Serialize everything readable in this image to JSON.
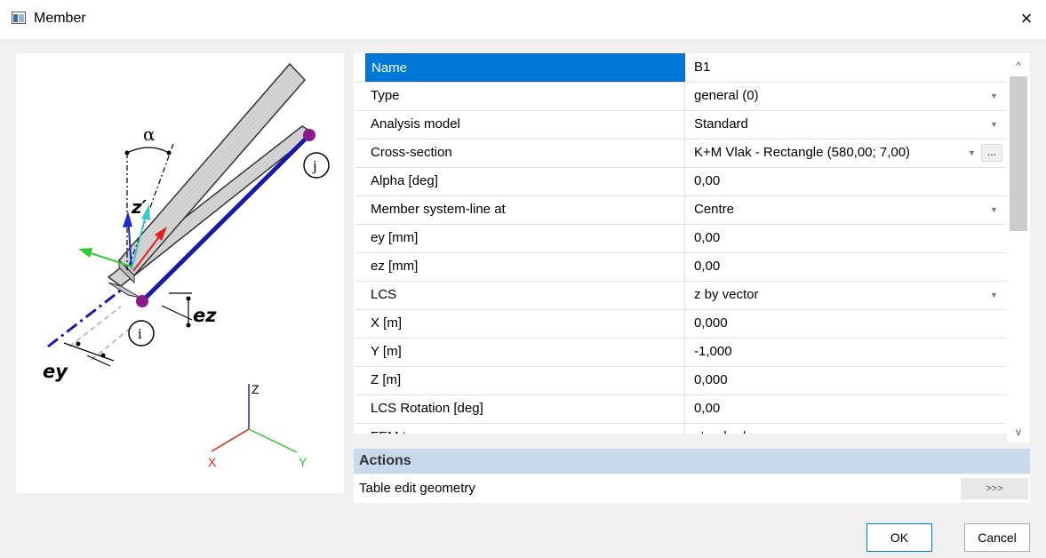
{
  "window": {
    "title": "Member",
    "close_glyph": "×",
    "app_icon": "window-icon"
  },
  "diagram": {
    "alpha_label": "α",
    "z_prime_label": "z′",
    "node_j": "j",
    "node_i": "i",
    "ez_label": "ez",
    "ey_label": "ey",
    "axis_z": "Z",
    "axis_x": "X",
    "axis_y": "Y"
  },
  "properties": [
    {
      "name": "Name",
      "value": "B1",
      "control": "text"
    },
    {
      "name": "Type",
      "value": "general (0)",
      "control": "dropdown"
    },
    {
      "name": "Analysis model",
      "value": "Standard",
      "control": "dropdown"
    },
    {
      "name": "Cross-section",
      "value": "K+M Vlak - Rectangle (580,00; 7,00)",
      "control": "dropdown-ellipsis"
    },
    {
      "name": "Alpha [deg]",
      "value": "0,00",
      "control": "text"
    },
    {
      "name": "Member system-line at",
      "value": "Centre",
      "control": "dropdown"
    },
    {
      "name": "ey [mm]",
      "value": "0,00",
      "control": "text"
    },
    {
      "name": "ez [mm]",
      "value": "0,00",
      "control": "text"
    },
    {
      "name": "LCS",
      "value": "z by vector",
      "control": "dropdown"
    },
    {
      "name": "X [m]",
      "value": "0,000",
      "control": "text"
    },
    {
      "name": "Y [m]",
      "value": "-1,000",
      "control": "text"
    },
    {
      "name": "Z [m]",
      "value": "0,000",
      "control": "text"
    },
    {
      "name": "LCS Rotation [deg]",
      "value": "0,00",
      "control": "text"
    },
    {
      "name": "FEM type",
      "value": "standard",
      "control": "text"
    }
  ],
  "dropdown_glyph": "▼",
  "ellipsis_label": "...",
  "scroll": {
    "up": "^",
    "down": "v"
  },
  "actions": {
    "header": "Actions",
    "items": [
      {
        "label": "Table edit geometry",
        "button": ">>>"
      }
    ]
  },
  "buttons": {
    "ok": "OK",
    "cancel": "Cancel"
  }
}
